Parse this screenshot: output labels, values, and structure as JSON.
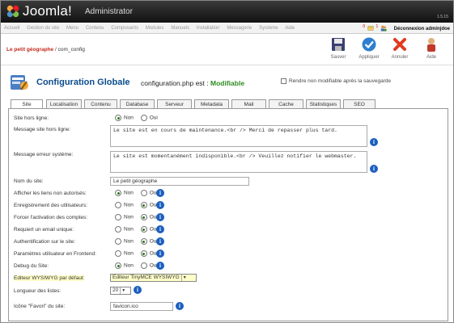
{
  "header": {
    "logo_text": "Joomla!",
    "subtitle": "Administrator",
    "version": "1.5.15"
  },
  "menu": {
    "items": [
      "Accueil",
      "Gestion du site",
      "Menu",
      "Contenu",
      "Composants",
      "Modules",
      "Manuels",
      "Installation",
      "Messagerie",
      "Système",
      "Aide"
    ]
  },
  "status": {
    "count_a": "0",
    "count_b": "1",
    "logout": "Déconnexion adminjdoe"
  },
  "breadcrumb": {
    "site": "Le petit géographe",
    "path": "/ com_config"
  },
  "toolbar": {
    "save": "Sauver",
    "apply": "Appliquer",
    "cancel": "Annuler",
    "help": "Aide"
  },
  "title": {
    "main": "Configuration Globale",
    "file": "configuration.php est :",
    "file_status": "Modifiable",
    "readonly_label": "Rendre non modifiable après la sauvegarde"
  },
  "tabs": [
    "Site",
    "Localisation",
    "Contenu",
    "Database",
    "Serveur",
    "Metadata",
    "Mail",
    "Cache",
    "Statistiques",
    "SEO"
  ],
  "form": {
    "offline_label": "Site hors ligne:",
    "offline_msg_label": "Message site hors ligne:",
    "offline_msg_value": "Le site est en cours de maintenance.<br /> Merci de repasser plus tard.",
    "error_msg_label": "Message erreur système:",
    "error_msg_value": "Le site est momentanément indisponible.<br /> Veuillez notifier le webmaster.",
    "sitename_label": "Nom du site:",
    "sitename_value": "Le petit géographe",
    "show_unauth_label": "Afficher les liens non autorisés:",
    "user_reg_label": "Enregistrement des utilisateurs:",
    "force_activation_label": "Forcer l'activation des comptes:",
    "unique_email_label": "Requiert un email unique:",
    "site_auth_label": "Authentification sur le site:",
    "frontend_params_label": "Paramètres utilisateur en Frontend:",
    "debug_label": "Debug du Site:",
    "editor_label": "Editeur WYSIWYG par défaut:",
    "editor_value": "Editeur TinyMCE WYSIWYG",
    "list_length_label": "Longueur des listes:",
    "list_length_value": "20",
    "favicon_label": "Icône \"Favori\" du site:",
    "favicon_value": "favicon.ico",
    "no": "Non",
    "yes": "Oui"
  }
}
